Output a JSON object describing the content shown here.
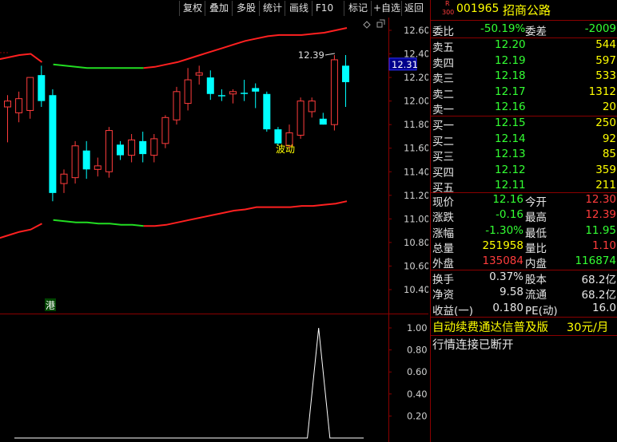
{
  "toolbar": {
    "buttons": [
      "复权",
      "叠加",
      "多股",
      "统计",
      "画线",
      "F10",
      "标记",
      "+自选",
      "返回"
    ]
  },
  "stock": {
    "badge_top": "R",
    "badge_bottom": "300",
    "code": "001965",
    "name": "招商公路"
  },
  "ratio": {
    "label1": "委比",
    "value1": "-50.19%",
    "label2": "委差",
    "value2": "-2009"
  },
  "asks": [
    {
      "label": "卖五",
      "price": "12.20",
      "vol": "544"
    },
    {
      "label": "卖四",
      "price": "12.19",
      "vol": "597"
    },
    {
      "label": "卖三",
      "price": "12.18",
      "vol": "533"
    },
    {
      "label": "卖二",
      "price": "12.17",
      "vol": "1312"
    },
    {
      "label": "卖一",
      "price": "12.16",
      "vol": "20"
    }
  ],
  "bids": [
    {
      "label": "买一",
      "price": "12.15",
      "vol": "250"
    },
    {
      "label": "买二",
      "price": "12.14",
      "vol": "92"
    },
    {
      "label": "买三",
      "price": "12.13",
      "vol": "85"
    },
    {
      "label": "买四",
      "price": "12.12",
      "vol": "359"
    },
    {
      "label": "买五",
      "price": "12.11",
      "vol": "211"
    }
  ],
  "stats1": [
    {
      "l1": "现价",
      "v1": "12.16",
      "c1": "green",
      "l2": "今开",
      "v2": "12.30",
      "c2": "red"
    },
    {
      "l1": "涨跌",
      "v1": "-0.16",
      "c1": "green",
      "l2": "最高",
      "v2": "12.39",
      "c2": "red"
    },
    {
      "l1": "涨幅",
      "v1": "-1.30%",
      "c1": "green",
      "l2": "最低",
      "v2": "11.95",
      "c2": "green"
    },
    {
      "l1": "总量",
      "v1": "251958",
      "c1": "yellow",
      "l2": "量比",
      "v2": "1.10",
      "c2": "red"
    },
    {
      "l1": "外盘",
      "v1": "135084",
      "c1": "red",
      "l2": "内盘",
      "v2": "116874",
      "c2": "green"
    }
  ],
  "stats2": [
    {
      "l1": "换手",
      "v1": "0.37%",
      "l2": "股本",
      "v2": "68.2亿"
    },
    {
      "l1": "净资",
      "v1": "9.58",
      "l2": "流通",
      "v2": "68.2亿"
    },
    {
      "l1": "收益(一)",
      "v1": "0.180",
      "l2": "PE(动)",
      "v2": "16.0"
    }
  ],
  "promo": {
    "text": "自动续费通达信普及版",
    "price": "30元/月"
  },
  "status_text": "行情连接已断开",
  "chart": {
    "price_ticks": [
      "12.60",
      "12.40",
      "12.20",
      "12.00",
      "11.80",
      "11.60",
      "11.40",
      "11.20",
      "11.00",
      "10.80",
      "10.60",
      "10.40"
    ],
    "current_price_label": "12.31",
    "high_marker": "12.39",
    "annotation": "波动",
    "hk_tag": "港",
    "sub_ticks": [
      "1.00",
      "0.80",
      "0.60",
      "0.40",
      "0.20"
    ],
    "colors": {
      "up": "#ff3c3c",
      "down": "#00ffff",
      "band_red": "#ff2020",
      "band_green": "#22dd22",
      "frame": "#8b0000"
    }
  },
  "chart_data": {
    "type": "candlestick",
    "ylim": [
      10.3,
      12.68
    ],
    "candles": [
      {
        "o": 11.95,
        "h": 12.05,
        "l": 11.65,
        "c": 12.0
      },
      {
        "o": 11.9,
        "h": 12.08,
        "l": 11.82,
        "c": 12.02
      },
      {
        "o": 11.92,
        "h": 12.15,
        "l": 11.85,
        "c": 12.2
      },
      {
        "o": 12.22,
        "h": 12.3,
        "l": 11.95,
        "c": 12.0
      },
      {
        "o": 12.05,
        "h": 12.1,
        "l": 11.15,
        "c": 11.22
      },
      {
        "o": 11.3,
        "h": 11.42,
        "l": 11.22,
        "c": 11.38
      },
      {
        "o": 11.35,
        "h": 11.66,
        "l": 11.3,
        "c": 11.62
      },
      {
        "o": 11.58,
        "h": 11.66,
        "l": 11.34,
        "c": 11.42
      },
      {
        "o": 11.42,
        "h": 11.52,
        "l": 11.36,
        "c": 11.45
      },
      {
        "o": 11.4,
        "h": 11.78,
        "l": 11.35,
        "c": 11.75
      },
      {
        "o": 11.63,
        "h": 11.66,
        "l": 11.5,
        "c": 11.54
      },
      {
        "o": 11.54,
        "h": 11.72,
        "l": 11.48,
        "c": 11.67
      },
      {
        "o": 11.66,
        "h": 11.74,
        "l": 11.48,
        "c": 11.55
      },
      {
        "o": 11.54,
        "h": 11.72,
        "l": 11.48,
        "c": 11.68
      },
      {
        "o": 11.64,
        "h": 11.88,
        "l": 11.6,
        "c": 11.86
      },
      {
        "o": 11.84,
        "h": 12.12,
        "l": 11.8,
        "c": 12.08
      },
      {
        "o": 11.98,
        "h": 12.28,
        "l": 11.92,
        "c": 12.18
      },
      {
        "o": 12.22,
        "h": 12.3,
        "l": 12.14,
        "c": 12.24
      },
      {
        "o": 12.2,
        "h": 12.26,
        "l": 12.01,
        "c": 12.06
      },
      {
        "o": 12.05,
        "h": 12.1,
        "l": 12.0,
        "c": 12.04
      },
      {
        "o": 12.06,
        "h": 12.1,
        "l": 11.98,
        "c": 12.08
      },
      {
        "o": 12.07,
        "h": 12.18,
        "l": 12.0,
        "c": 12.06
      },
      {
        "o": 12.11,
        "h": 12.15,
        "l": 11.94,
        "c": 12.08
      },
      {
        "o": 12.06,
        "h": 12.08,
        "l": 11.74,
        "c": 11.76
      },
      {
        "o": 11.76,
        "h": 11.78,
        "l": 11.62,
        "c": 11.64
      },
      {
        "o": 11.62,
        "h": 11.8,
        "l": 11.58,
        "c": 11.73
      },
      {
        "o": 11.71,
        "h": 12.03,
        "l": 11.68,
        "c": 12.0
      },
      {
        "o": 11.91,
        "h": 12.03,
        "l": 11.86,
        "c": 12.0
      },
      {
        "o": 11.85,
        "h": 11.9,
        "l": 11.8,
        "c": 11.8
      },
      {
        "o": 11.8,
        "h": 12.39,
        "l": 11.75,
        "c": 12.35
      },
      {
        "o": 12.3,
        "h": 12.39,
        "l": 11.95,
        "c": 12.16
      }
    ],
    "upper_band": [
      12.35,
      12.37,
      12.39,
      12.4,
      12.33,
      12.31,
      12.3,
      12.29,
      12.28,
      12.28,
      12.28,
      12.28,
      12.28,
      12.28,
      12.29,
      12.31,
      12.33,
      12.36,
      12.39,
      12.42,
      12.45,
      12.48,
      12.51,
      12.53,
      12.55,
      12.56,
      12.56,
      12.56,
      12.57,
      12.58,
      12.6,
      12.62
    ],
    "upper_green_range": [
      4,
      13
    ],
    "lower_band": [
      10.83,
      10.86,
      10.89,
      10.91,
      10.96,
      10.99,
      10.98,
      10.97,
      10.97,
      10.96,
      10.96,
      10.95,
      10.95,
      10.94,
      10.94,
      10.95,
      10.97,
      10.99,
      11.01,
      11.03,
      11.05,
      11.07,
      11.08,
      11.1,
      11.1,
      11.1,
      11.1,
      11.11,
      11.11,
      11.12,
      11.13,
      11.15
    ],
    "lower_green_range": [
      4,
      13
    ],
    "sub_series": [
      0,
      0,
      0,
      0,
      0,
      0,
      0,
      0,
      0,
      0,
      0,
      0,
      0,
      0,
      0,
      0,
      0,
      0,
      0,
      0,
      0,
      0,
      0,
      0,
      0,
      0,
      0,
      1,
      0,
      0,
      0,
      0
    ],
    "sub_ylim": [
      0,
      1.1
    ]
  }
}
